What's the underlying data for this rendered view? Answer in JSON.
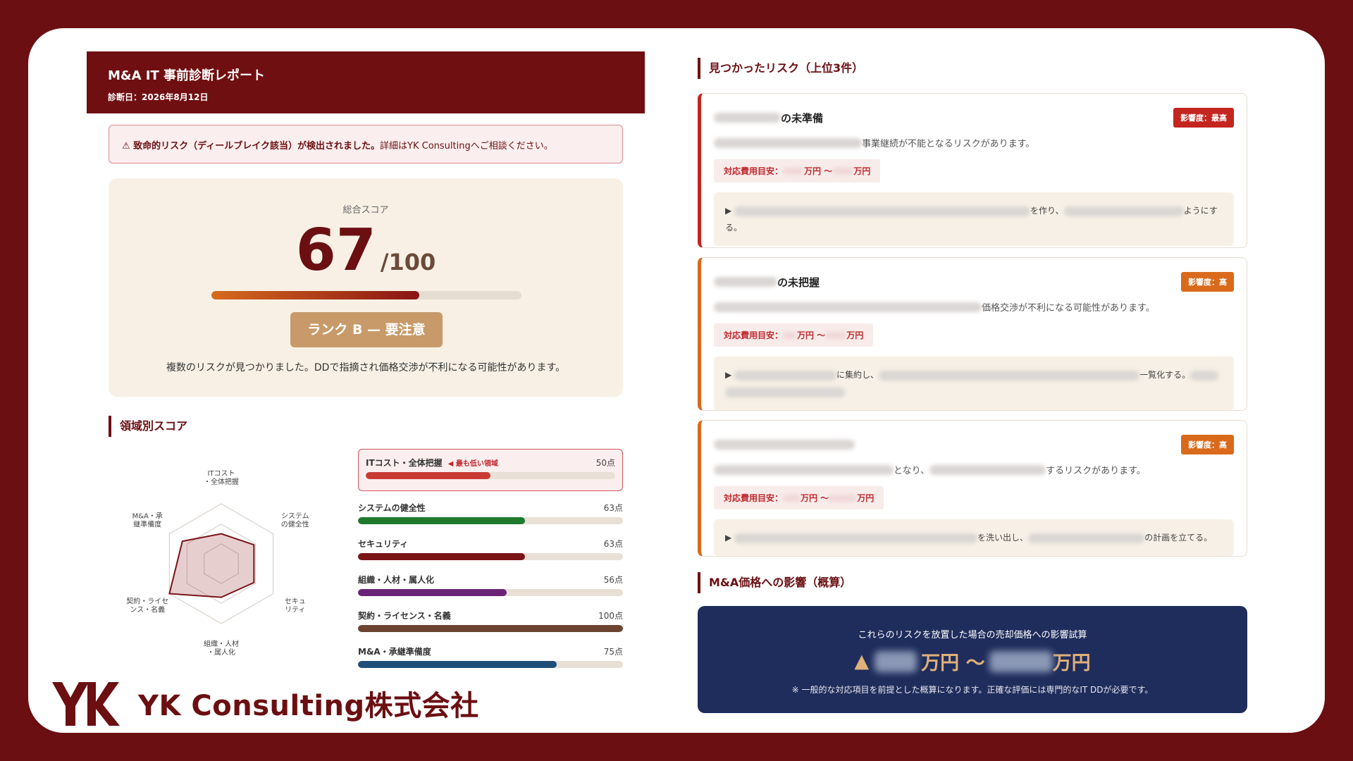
{
  "report": {
    "title": "M&A IT 事前診断レポート",
    "date": "診断日：2026年8月12日"
  },
  "alert": {
    "bold": "⚠ 致命的リスク（ディールブレイク該当）が検出されました。",
    "rest": "詳細はYK Consultingへご相談ください。"
  },
  "score": {
    "label": "総合スコア",
    "value": "67",
    "denominator": "/100",
    "progress_percent": 67,
    "rank": "ランク B — 要注意",
    "message": "複数のリスクが見つかりました。DDで指摘され価格交渉が不利になる可能性があります。"
  },
  "domains_heading": "領域別スコア",
  "radar": {
    "labels": [
      [
        "ITコスト",
        "・全体把握"
      ],
      [
        "システム",
        "の健全性"
      ],
      [
        "セキュ",
        "リティ"
      ],
      [
        "組織・人材",
        "・属人化"
      ],
      [
        "契約・ライセ",
        "ンス・名義"
      ],
      [
        "M&A・承",
        "継準備度"
      ]
    ],
    "values": [
      50,
      63,
      63,
      56,
      100,
      75
    ]
  },
  "domains": [
    {
      "name": "ITコスト・全体把握",
      "score": "50点",
      "value": 50,
      "color": "#c73b34",
      "flag": "◀ 最も低い領域"
    },
    {
      "name": "システムの健全性",
      "score": "63点",
      "value": 63,
      "color": "#1f7a2e"
    },
    {
      "name": "セキュリティ",
      "score": "63点",
      "value": 63,
      "color": "#7a1417"
    },
    {
      "name": "組織・人材・属人化",
      "score": "56点",
      "value": 56,
      "color": "#6a2277"
    },
    {
      "name": "契約・ライセンス・名義",
      "score": "100点",
      "value": 100,
      "color": "#6b4330"
    },
    {
      "name": "M&A・承継準備度",
      "score": "75点",
      "value": 75,
      "color": "#1e4f7a"
    }
  ],
  "risks_heading": "見つかったリスク（上位3件）",
  "risks": [
    {
      "title_suffix": "の未準備",
      "badge": "影響度：最高",
      "badge_color": "#c4251f",
      "desc": "事業継続が不能となるリスクがあります。",
      "cost_label": "対応費用目安：",
      "cost_unit_a": "万円 〜",
      "cost_unit_b": "万円",
      "action_a": "を作り、",
      "action_b": "ようにす",
      "action_c": "る。"
    },
    {
      "title_suffix": "の未把握",
      "badge": "影響度：高",
      "badge_color": "#d96a1c",
      "desc": "価格交渉が不利になる可能性があります。",
      "cost_label": "対応費用目安：",
      "cost_unit_a": "万円 〜",
      "cost_unit_b": "万円",
      "action_a": "に集約し、",
      "action_b": "一覧化する。"
    },
    {
      "badge": "影響度：高",
      "badge_color": "#d96a1c",
      "desc_a": "となり、",
      "desc_b": "するリスクがあります。",
      "cost_label": "対応費用目安：",
      "cost_unit_a": "万円 〜",
      "cost_unit_b": "万円",
      "action_a": "を洗い出し、",
      "action_b": "の計画を立てる。"
    }
  ],
  "impact_heading": "M&A価格への影響（概算）",
  "impact": {
    "line1": "これらのリスクを放置した場合の売却価格への影響試算",
    "arrow": "▲",
    "unit_a": "万円 〜",
    "unit_b": "万円",
    "note": "※ 一般的な対応項目を前提とした概算になります。正確な評価には専門的なIT DDが必要です。"
  },
  "brand": {
    "name": "YK Consulting株式会社",
    "logo_icon": "yk-logo-icon"
  }
}
